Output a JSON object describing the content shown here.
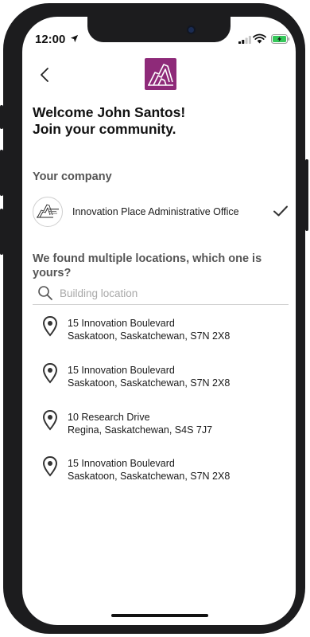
{
  "status_bar": {
    "time": "12:00"
  },
  "header": {
    "back_icon": "chevron-left-icon",
    "logo_icon": "building-logo-icon",
    "brand_color": "#8e2a79"
  },
  "welcome": {
    "line1": "Welcome John Santos!",
    "line2": "Join your community."
  },
  "company": {
    "section_label": "Your company",
    "name": "Innovation Place Administrative Office",
    "selected": true
  },
  "locations": {
    "question": "We found multiple locations, which one is yours?",
    "search_placeholder": "Building location",
    "items": [
      {
        "line1": "15 Innovation Boulevard",
        "line2": "Saskatoon, Saskatchewan, S7N 2X8"
      },
      {
        "line1": "15 Innovation Boulevard",
        "line2": "Saskatoon, Saskatchewan, S7N 2X8"
      },
      {
        "line1": "10 Research Drive",
        "line2": "Regina, Saskatchewan, S4S 7J7"
      },
      {
        "line1": "15 Innovation Boulevard",
        "line2": "Saskatoon, Saskatchewan, S7N 2X8"
      }
    ]
  }
}
